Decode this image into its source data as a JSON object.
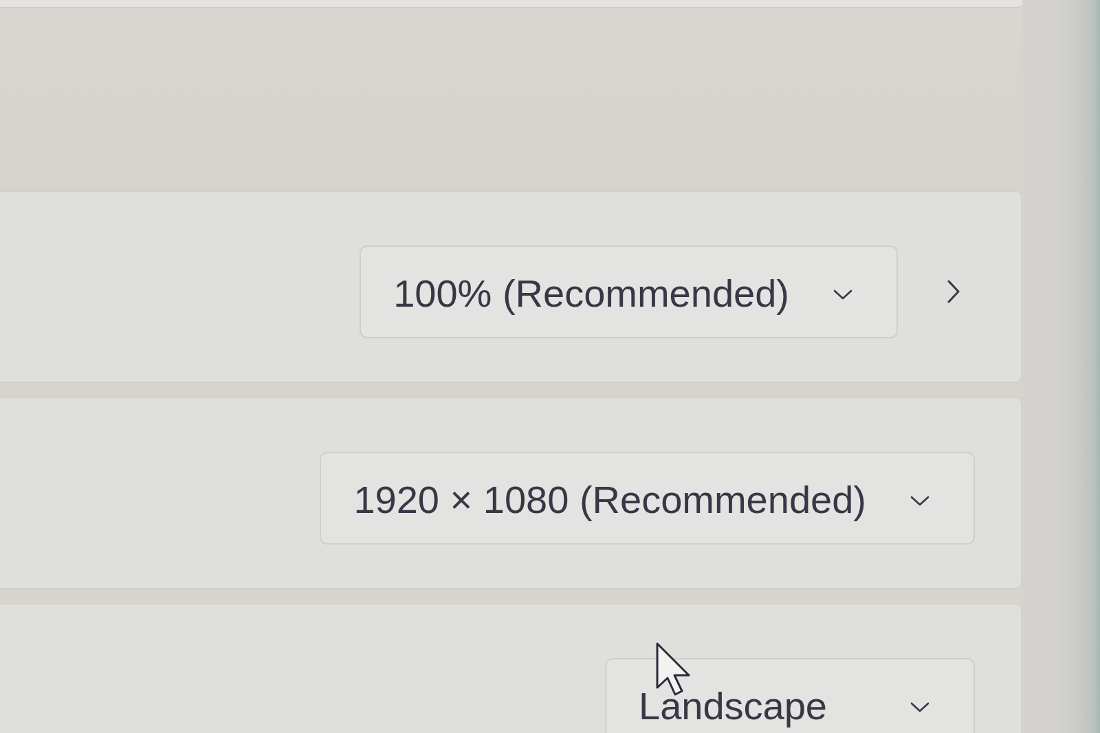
{
  "settings": [
    {
      "value": "100% (Recommended)",
      "opens_page": true
    },
    {
      "value": "1920 × 1080 (Recommended)",
      "opens_page": false
    },
    {
      "value": "Landscape",
      "opens_page": false
    }
  ]
}
